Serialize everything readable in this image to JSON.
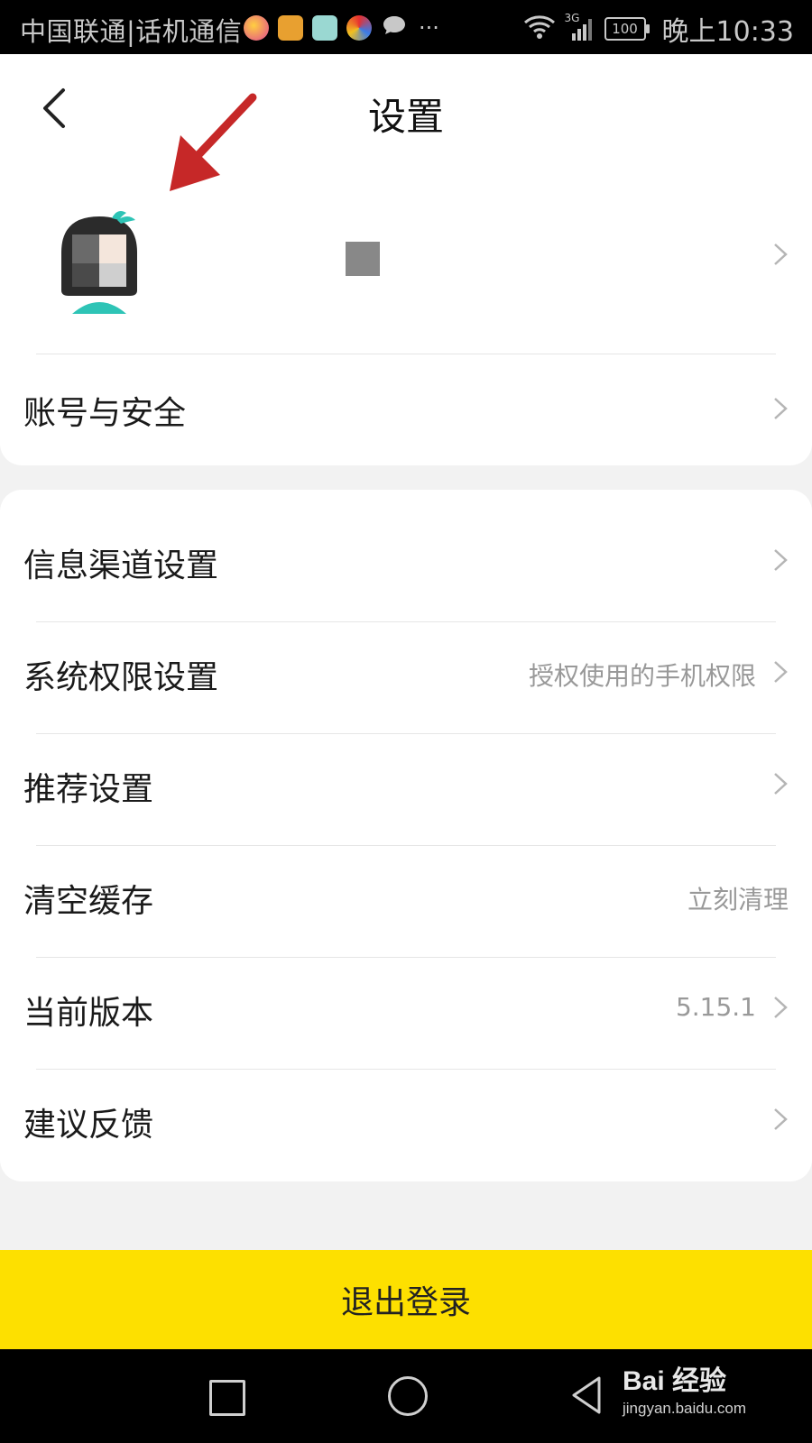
{
  "status_bar": {
    "carrier": "中国联通|话机通信",
    "network": "3G",
    "battery": "100",
    "time": "晚上10:33",
    "more": "···"
  },
  "header": {
    "title": "设置"
  },
  "profile": {
    "avatar": "avatar-girl"
  },
  "account_section": {
    "items": [
      {
        "label": "账号与安全"
      }
    ]
  },
  "settings_section": {
    "items": [
      {
        "label": "信息渠道设置",
        "value": ""
      },
      {
        "label": "系统权限设置",
        "value": "授权使用的手机权限"
      },
      {
        "label": "推荐设置",
        "value": ""
      },
      {
        "label": "清空缓存",
        "value": "立刻清理"
      },
      {
        "label": "当前版本",
        "value": "5.15.1"
      },
      {
        "label": "建议反馈",
        "value": ""
      }
    ]
  },
  "logout": {
    "label": "退出登录"
  },
  "watermark": {
    "brand": "Bai 经验",
    "url": "jingyan.baidu.com"
  },
  "colors": {
    "accent_yellow": "#fde000",
    "background": "#f2f2f2",
    "annotation_arrow": "#c62828"
  }
}
